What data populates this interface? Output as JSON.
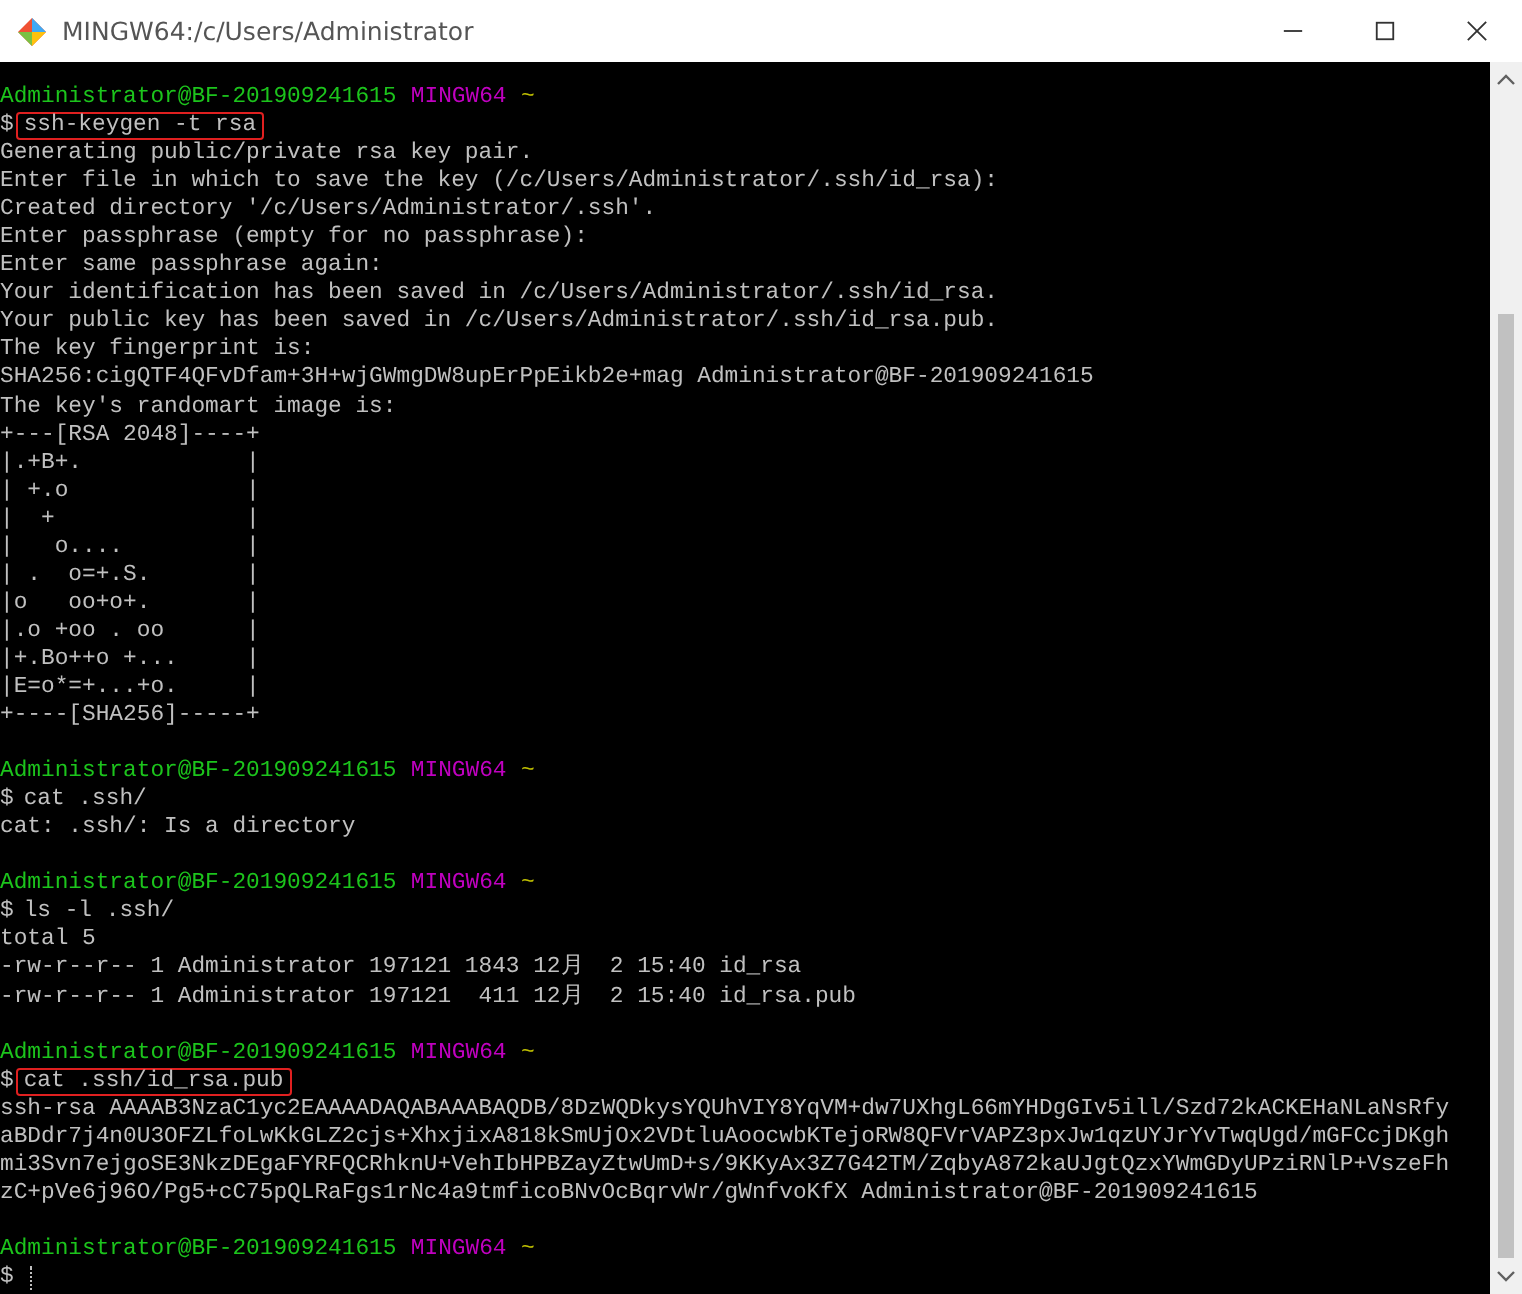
{
  "window": {
    "title": "MINGW64:/c/Users/Administrator"
  },
  "terminal": {
    "lines": [
      {
        "kind": "prompt",
        "user_host": "Administrator@BF-201909241615",
        "shell": "MINGW64",
        "dir": "~"
      },
      {
        "kind": "command",
        "sign": "$",
        "text": "ssh-keygen -t rsa",
        "highlighted": true
      },
      {
        "kind": "output",
        "text": "Generating public/private rsa key pair."
      },
      {
        "kind": "output",
        "text": "Enter file in which to save the key (/c/Users/Administrator/.ssh/id_rsa):"
      },
      {
        "kind": "output",
        "text": "Created directory '/c/Users/Administrator/.ssh'."
      },
      {
        "kind": "output",
        "text": "Enter passphrase (empty for no passphrase):"
      },
      {
        "kind": "output",
        "text": "Enter same passphrase again:"
      },
      {
        "kind": "output",
        "text": "Your identification has been saved in /c/Users/Administrator/.ssh/id_rsa."
      },
      {
        "kind": "output",
        "text": "Your public key has been saved in /c/Users/Administrator/.ssh/id_rsa.pub."
      },
      {
        "kind": "output",
        "text": "The key fingerprint is:"
      },
      {
        "kind": "output",
        "text": "SHA256:cigQTF4QFvDfam+3H+wjGWmgDW8upErPpEikb2e+mag Administrator@BF-201909241615"
      },
      {
        "kind": "output",
        "text": "The key's randomart image is:"
      },
      {
        "kind": "output",
        "text": "+---[RSA 2048]----+"
      },
      {
        "kind": "output",
        "text": "|.+B+.            |"
      },
      {
        "kind": "output",
        "text": "| +.o             |"
      },
      {
        "kind": "output",
        "text": "|  +              |"
      },
      {
        "kind": "output",
        "text": "|   o....         |"
      },
      {
        "kind": "output",
        "text": "| .  o=+.S.       |"
      },
      {
        "kind": "output",
        "text": "|o   oo+o+.       |"
      },
      {
        "kind": "output",
        "text": "|.o +oo . oo      |"
      },
      {
        "kind": "output",
        "text": "|+.Bo++o +...     |"
      },
      {
        "kind": "output",
        "text": "|E=o*=+...+o.     |"
      },
      {
        "kind": "output",
        "text": "+----[SHA256]-----+"
      },
      {
        "kind": "blank"
      },
      {
        "kind": "prompt",
        "user_host": "Administrator@BF-201909241615",
        "shell": "MINGW64",
        "dir": "~"
      },
      {
        "kind": "command",
        "sign": "$",
        "text": "cat .ssh/",
        "highlighted": false
      },
      {
        "kind": "output",
        "text": "cat: .ssh/: Is a directory"
      },
      {
        "kind": "blank"
      },
      {
        "kind": "prompt",
        "user_host": "Administrator@BF-201909241615",
        "shell": "MINGW64",
        "dir": "~"
      },
      {
        "kind": "command",
        "sign": "$",
        "text": "ls -l .ssh/",
        "highlighted": false
      },
      {
        "kind": "output",
        "text": "total 5"
      },
      {
        "kind": "output",
        "text": "-rw-r--r-- 1 Administrator 197121 1843 12月  2 15:40 id_rsa"
      },
      {
        "kind": "output",
        "text": "-rw-r--r-- 1 Administrator 197121  411 12月  2 15:40 id_rsa.pub"
      },
      {
        "kind": "blank"
      },
      {
        "kind": "prompt",
        "user_host": "Administrator@BF-201909241615",
        "shell": "MINGW64",
        "dir": "~"
      },
      {
        "kind": "command",
        "sign": "$",
        "text": "cat .ssh/id_rsa.pub",
        "highlighted": true
      },
      {
        "kind": "output",
        "text": "ssh-rsa AAAAB3NzaC1yc2EAAAADAQABAAABAQDB/8DzWQDkysYQUhVIY8YqVM+dw7UXhgL66mYHDgGIv5ill/Szd72kACKEHaNLaNsRfy"
      },
      {
        "kind": "output",
        "text": "aBDdr7j4n0U3OFZLfoLwKkGLZ2cjs+XhxjixA818kSmUjOx2VDtluAoocwbKTejoRW8QFVrVAPZ3pxJw1qzUYJrYvTwqUgd/mGFCcjDKgh"
      },
      {
        "kind": "output",
        "text": "mi3Svn7ejgoSE3NkzDEgaFYRFQCRhknU+VehIbHPBZayZtwUmD+s/9KKyAx3Z7G42TM/ZqbyA872kaUJgtQzxYWmGDyUPziRNlP+VszeFh"
      },
      {
        "kind": "output",
        "text": "zC+pVe6j96O/Pg5+cC75pQLRaFgs1rNc4a9tmficoBNvOcBqrvWr/gWnfvoKfX Administrator@BF-201909241615"
      },
      {
        "kind": "blank"
      },
      {
        "kind": "prompt",
        "user_host": "Administrator@BF-201909241615",
        "shell": "MINGW64",
        "dir": "~"
      },
      {
        "kind": "input",
        "sign": "$",
        "cursor": true
      }
    ]
  }
}
